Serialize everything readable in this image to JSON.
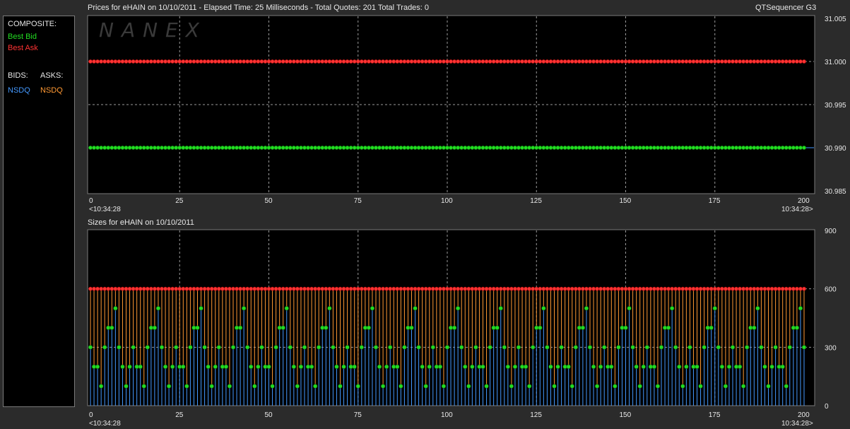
{
  "header": {
    "title": "Prices for  eHAIN  on  10/10/2011  -  Elapsed Time: 25 Milliseconds  -  Total Quotes: 201  Total Trades: 0",
    "app_name": "QTSequencer G3",
    "sizes_title": "Sizes for  eHAIN  on  10/10/2011"
  },
  "legend": {
    "composite_label": "COMPOSITE:",
    "best_bid": "Best Bid",
    "best_ask": "Best Ask",
    "bids_label": "BIDS:",
    "asks_label": "ASKS:",
    "bid_exchange": "NSDQ",
    "ask_exchange": "NSDQ"
  },
  "watermark": "NANEX",
  "colors": {
    "bid": "#22dd22",
    "ask": "#ff3333",
    "nsdq_bid": "#4499ff",
    "nsdq_ask": "#ff9933",
    "background": "#000000",
    "frame": "#2b2b2b"
  },
  "chart_data": [
    {
      "type": "line",
      "name": "prices",
      "x_ticks": [
        0,
        25,
        50,
        75,
        100,
        125,
        150,
        175,
        200
      ],
      "xlim": [
        0,
        200
      ],
      "ylim": [
        30.985,
        31.005
      ],
      "y_ticks": [
        "31.005",
        "31.000",
        "30.995",
        "30.990",
        "30.985"
      ],
      "x_start_label": "<10:34:28",
      "x_end_label": "10:34:28>",
      "series": [
        {
          "name": "Best Ask",
          "constant": 31.0,
          "points": 201
        },
        {
          "name": "Best Bid",
          "constant": 30.99,
          "points": 201
        }
      ],
      "grid": true
    },
    {
      "type": "bar",
      "name": "sizes",
      "x_ticks": [
        0,
        25,
        50,
        75,
        100,
        125,
        150,
        175,
        200
      ],
      "xlim": [
        0,
        200
      ],
      "ylim": [
        0,
        900
      ],
      "y_ticks": [
        "900",
        "600",
        "300",
        "0"
      ],
      "x_start_label": "<10:34:28",
      "x_end_label": "10:34:28>",
      "ask_size_constant": 600,
      "bid_size_cycle": [
        300,
        200,
        200,
        100,
        300,
        400,
        400,
        500,
        300,
        200,
        100,
        200
      ],
      "grid": true
    }
  ]
}
